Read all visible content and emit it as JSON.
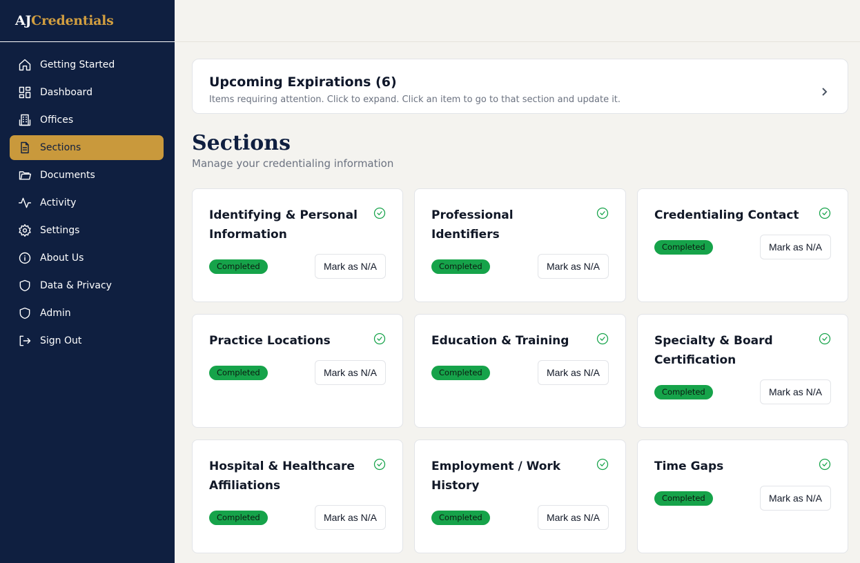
{
  "brand": {
    "part1": "AJ",
    "part2": "Credentials",
    "accent_color": "#d19e40"
  },
  "sidebar": {
    "items": [
      {
        "label": "Getting Started",
        "icon": "home-icon"
      },
      {
        "label": "Dashboard",
        "icon": "grid-icon"
      },
      {
        "label": "Offices",
        "icon": "building-icon"
      },
      {
        "label": "Sections",
        "icon": "document-icon",
        "active": true
      },
      {
        "label": "Documents",
        "icon": "folder-icon"
      },
      {
        "label": "Activity",
        "icon": "activity-icon"
      },
      {
        "label": "Settings",
        "icon": "gear-icon"
      },
      {
        "label": "About Us",
        "icon": "info-icon"
      },
      {
        "label": "Data & Privacy",
        "icon": "shield-icon"
      },
      {
        "label": "Admin",
        "icon": "shield-icon"
      },
      {
        "label": "Sign Out",
        "icon": "sign-out-icon"
      }
    ]
  },
  "expirations": {
    "title": "Upcoming Expirations (6)",
    "subtitle": "Items requiring attention. Click to expand. Click an item to go to that section and update it."
  },
  "sections": {
    "title": "Sections",
    "subtitle": "Manage your credentialing information",
    "cards": [
      {
        "title": "Identifying & Personal Information",
        "status": "Completed",
        "action": "Mark as N/A"
      },
      {
        "title": "Professional Identifiers",
        "status": "Completed",
        "action": "Mark as N/A"
      },
      {
        "title": "Credentialing Contact",
        "status": "Completed",
        "action": "Mark as N/A"
      },
      {
        "title": "Practice Locations",
        "status": "Completed",
        "action": "Mark as N/A"
      },
      {
        "title": "Education & Training",
        "status": "Completed",
        "action": "Mark as N/A"
      },
      {
        "title": "Specialty & Board Certification",
        "status": "Completed",
        "action": "Mark as N/A"
      },
      {
        "title": "Hospital & Healthcare Affiliations",
        "status": "Completed",
        "action": "Mark as N/A"
      },
      {
        "title": "Employment / Work History",
        "status": "Completed",
        "action": "Mark as N/A"
      },
      {
        "title": "Time Gaps",
        "status": "Completed",
        "action": "Mark as N/A"
      }
    ]
  },
  "colors": {
    "sidebar_bg": "#0f1f40",
    "active_nav": "#c9993c",
    "status_green": "#16a34a"
  }
}
